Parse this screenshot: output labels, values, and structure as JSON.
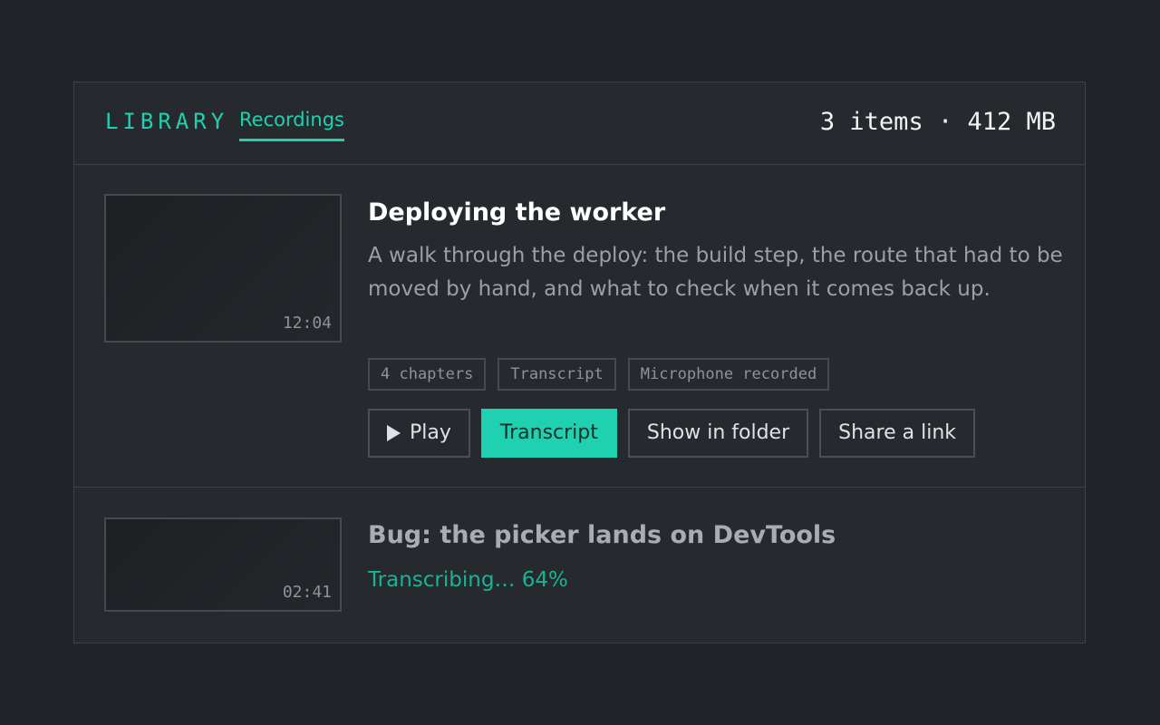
{
  "header": {
    "section_label": "LIBRARY",
    "tab_label": "Recordings",
    "summary": "3 items · 412 MB"
  },
  "recordings": [
    {
      "title": "Deploying the worker",
      "duration": "12:04",
      "description": "A walk through the deploy: the build step, the route that had to be moved by hand, and what to check when it comes back up.",
      "tags": [
        "4 chapters",
        "Transcript",
        "Microphone recorded"
      ],
      "actions": {
        "play": "Play",
        "transcript": "Transcript",
        "show_in_folder": "Show in folder",
        "share": "Share a link"
      }
    },
    {
      "title": "Bug: the picker lands on DevTools",
      "duration": "02:41",
      "status": "Transcribing… 64%",
      "progress_percent": 64
    }
  ],
  "colors": {
    "accent": "#1fd1b0",
    "background": "#212529",
    "panel": "#262a2e"
  },
  "icons": {
    "play": "play-icon"
  }
}
